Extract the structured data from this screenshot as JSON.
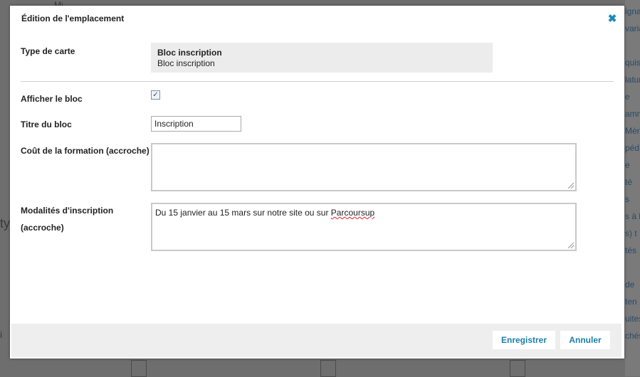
{
  "background": {
    "right_fragments": [
      "ignag",
      "varia",
      "quis",
      "latur",
      "e",
      "amm",
      "Mère",
      "péd",
      "e",
      "té",
      "s",
      "s à l",
      "s) t",
      "tés",
      "de",
      "ten",
      "uites",
      "chés"
    ],
    "left_fragments": [
      "Mi",
      "ty",
      "i"
    ]
  },
  "modal": {
    "title": "Édition de l'emplacement",
    "close_icon": "close-icon",
    "fields": {
      "card_type": {
        "label": "Type de carte",
        "value_title": "Bloc inscription",
        "value_sub": "Bloc inscription"
      },
      "show_block": {
        "label": "Afficher le bloc",
        "checked": true
      },
      "block_title": {
        "label": "Titre du bloc",
        "value": "Inscription"
      },
      "training_cost": {
        "label": "Coût de la formation (accroche)",
        "value": ""
      },
      "registration_terms": {
        "label_line1": "Modalités d'inscription",
        "label_line2": "(accroche)",
        "value_prefix": "Du 15 janvier au 15 mars sur notre site ou sur ",
        "value_misspelled": "Parcoursup"
      }
    },
    "footer": {
      "save_label": "Enregistrer",
      "cancel_label": "Annuler"
    },
    "colors": {
      "accent": "#1c7fa8",
      "overlay": "#6e6e6e"
    }
  }
}
